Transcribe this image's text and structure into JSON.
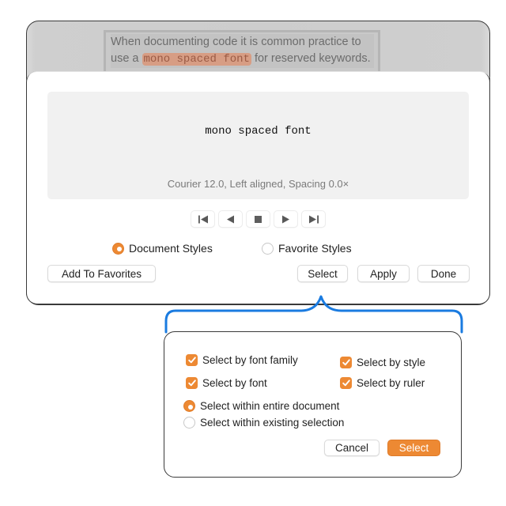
{
  "background_document": {
    "line1": "When documenting code it is common practice to",
    "line2_prefix": "use a",
    "line2_highlight": "mono spaced font",
    "line2_suffix": "for reserved keywords."
  },
  "style_panel": {
    "preview_sample": "mono spaced font",
    "preview_description": "Courier 12.0, Left aligned, Spacing 0.0×",
    "transport": [
      {
        "name": "first",
        "icon": "skip-to-start-icon"
      },
      {
        "name": "previous",
        "icon": "previous-icon"
      },
      {
        "name": "stop",
        "icon": "stop-icon"
      },
      {
        "name": "next",
        "icon": "next-icon"
      },
      {
        "name": "last",
        "icon": "skip-to-end-icon"
      }
    ],
    "source_options": [
      {
        "label": "Document Styles",
        "selected": true
      },
      {
        "label": "Favorite Styles",
        "selected": false
      }
    ],
    "buttons": {
      "add_to_favorites": "Add To Favorites",
      "select": "Select",
      "apply": "Apply",
      "done": "Done"
    }
  },
  "select_popover": {
    "checkboxes": [
      {
        "label": "Select by font family",
        "checked": true
      },
      {
        "label": "Select by style",
        "checked": true
      },
      {
        "label": "Select by font",
        "checked": true
      },
      {
        "label": "Select by ruler",
        "checked": true
      }
    ],
    "scope_options": [
      {
        "label": "Select within entire document",
        "selected": true
      },
      {
        "label": "Select within existing selection",
        "selected": false
      }
    ],
    "buttons": {
      "cancel": "Cancel",
      "select": "Select"
    }
  },
  "colors": {
    "accent": "#ed8933",
    "bracket": "#1a7be0",
    "highlight": "#d79d84"
  }
}
